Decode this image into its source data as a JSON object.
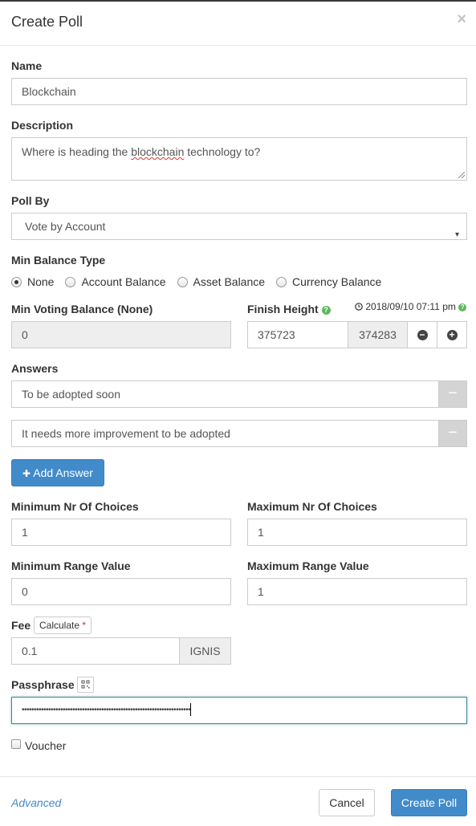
{
  "modal": {
    "title": "Create Poll",
    "close_glyph": "×"
  },
  "name": {
    "label": "Name",
    "value": "Blockchain"
  },
  "description": {
    "label": "Description",
    "value_before": "Where is heading the ",
    "value_misspelled": "blockchain",
    "value_after": " technology to?"
  },
  "poll_by": {
    "label": "Poll By",
    "selected": "Vote by Account",
    "caret": "▾"
  },
  "min_balance_type": {
    "label": "Min Balance Type",
    "options": [
      {
        "label": "None",
        "checked": true
      },
      {
        "label": "Account Balance",
        "checked": false
      },
      {
        "label": "Asset Balance",
        "checked": false
      },
      {
        "label": "Currency Balance",
        "checked": false
      }
    ]
  },
  "min_voting_balance": {
    "label": "Min Voting Balance (None)",
    "value": "0"
  },
  "finish_height": {
    "label": "Finish Height",
    "help": "?",
    "date": "2018/09/10 07:11 pm",
    "clock_glyph": "🕓",
    "value": "375723",
    "current_height": "374283",
    "minus_glyph": "−",
    "plus_glyph": "+"
  },
  "answers": {
    "label": "Answers",
    "items": [
      {
        "value": "To be adopted soon"
      },
      {
        "value": "It needs more improvement to be adopted"
      }
    ],
    "remove_glyph": "−",
    "add_label": "Add Answer",
    "add_glyph": "✚"
  },
  "choices": {
    "min_label": "Minimum Nr Of Choices",
    "min_value": "1",
    "max_label": "Maximum Nr Of Choices",
    "max_value": "1"
  },
  "range": {
    "min_label": "Minimum Range Value",
    "min_value": "0",
    "max_label": "Maximum Range Value",
    "max_value": "1"
  },
  "fee": {
    "label": "Fee",
    "calculate_label": "Calculate",
    "required_mark": "*",
    "value": "0.1",
    "unit": "IGNIS"
  },
  "passphrase": {
    "label": "Passphrase",
    "masked_value": "••••••••••••••••••••••••••••••••••••••••••••••••••••••••••••••••••••••"
  },
  "voucher": {
    "label": "Voucher",
    "checked": false
  },
  "footer": {
    "advanced_label": "Advanced",
    "cancel_label": "Cancel",
    "submit_label": "Create Poll"
  },
  "colors": {
    "primary": "#428bca",
    "help_green": "#5cb85c",
    "focus_border": "#3a8a9e"
  }
}
